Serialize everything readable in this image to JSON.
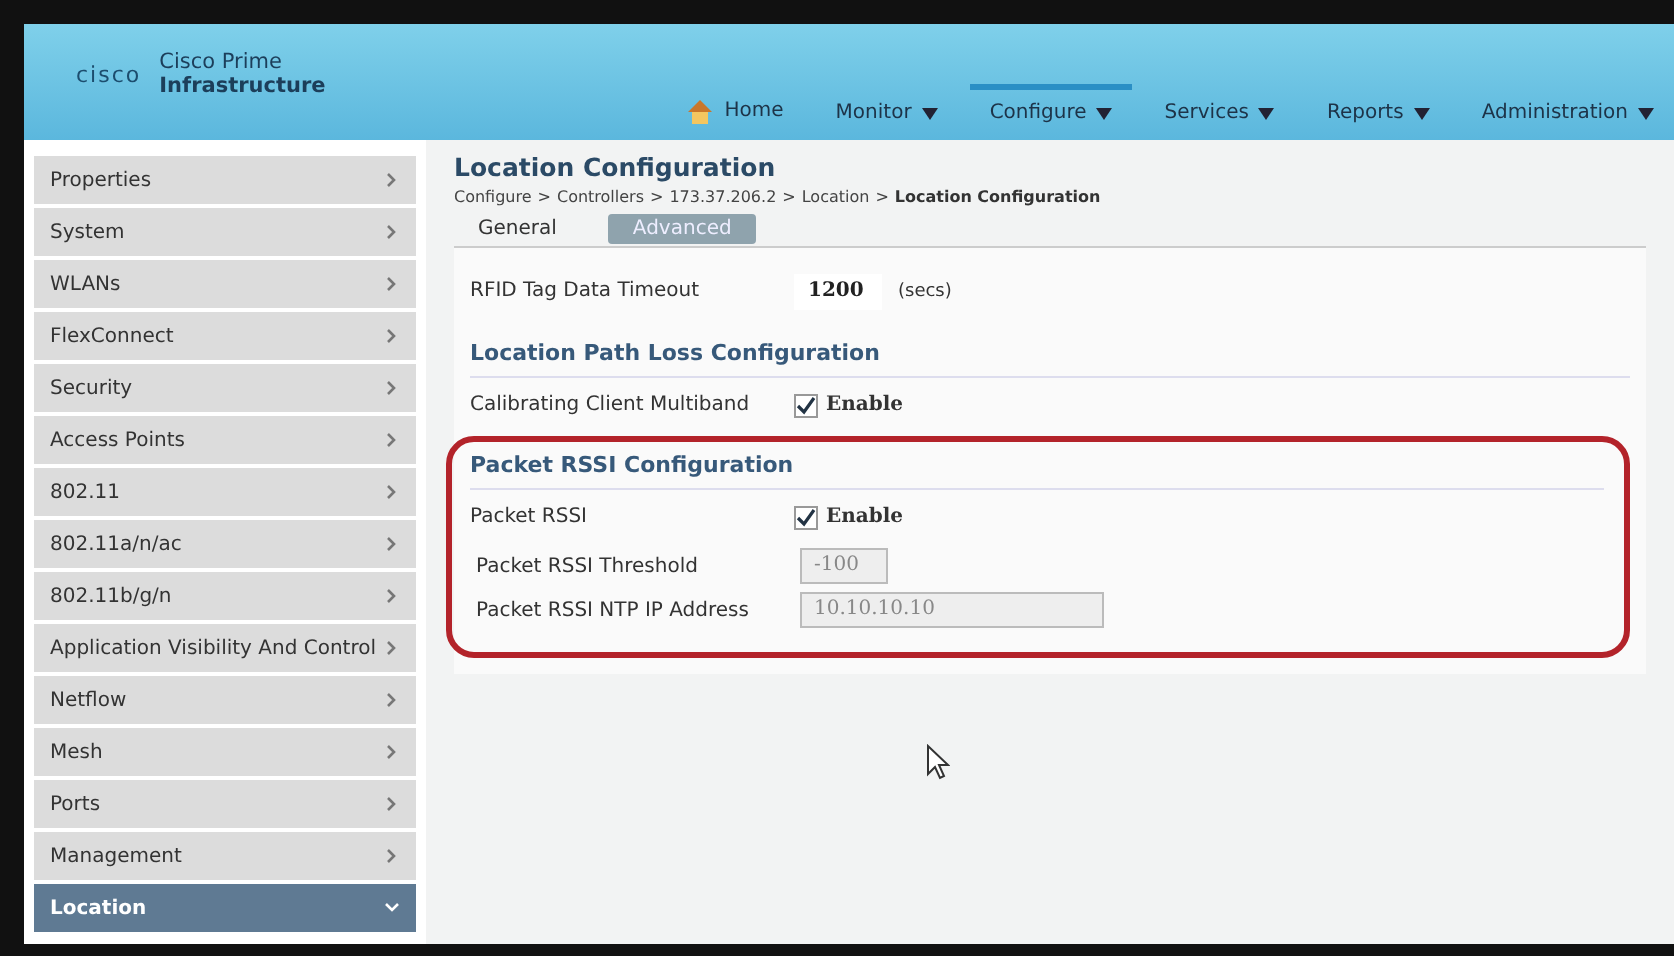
{
  "header": {
    "logo_top": "Cisco Prime",
    "logo_bottom": "Infrastructure",
    "brand": "cisco",
    "nav": [
      {
        "label": "Home",
        "kind": "home",
        "selected": false
      },
      {
        "label": "Monitor",
        "kind": "menu",
        "selected": false
      },
      {
        "label": "Configure",
        "kind": "menu",
        "selected": true
      },
      {
        "label": "Services",
        "kind": "menu",
        "selected": false
      },
      {
        "label": "Reports",
        "kind": "menu",
        "selected": false
      },
      {
        "label": "Administration",
        "kind": "menu",
        "selected": false
      }
    ]
  },
  "sidebar": {
    "items": [
      {
        "label": "Properties",
        "selected": false
      },
      {
        "label": "System",
        "selected": false
      },
      {
        "label": "WLANs",
        "selected": false
      },
      {
        "label": "FlexConnect",
        "selected": false
      },
      {
        "label": "Security",
        "selected": false
      },
      {
        "label": "Access Points",
        "selected": false
      },
      {
        "label": "802.11",
        "selected": false
      },
      {
        "label": "802.11a/n/ac",
        "selected": false
      },
      {
        "label": "802.11b/g/n",
        "selected": false
      },
      {
        "label": "Application Visibility And Control",
        "selected": false
      },
      {
        "label": "Netflow",
        "selected": false
      },
      {
        "label": "Mesh",
        "selected": false
      },
      {
        "label": "Ports",
        "selected": false
      },
      {
        "label": "Management",
        "selected": false
      },
      {
        "label": "Location",
        "selected": true
      }
    ]
  },
  "page": {
    "title": "Location Configuration",
    "breadcrumb": [
      {
        "label": "Configure",
        "current": false
      },
      {
        "sep": ">",
        "label": "Controllers",
        "current": false
      },
      {
        "sep": ">",
        "label": "173.37.206.2",
        "current": false
      },
      {
        "sep": ">",
        "label": "Location",
        "current": false
      },
      {
        "sep": ">",
        "label": "Location Configuration",
        "current": true
      }
    ],
    "tabs": [
      {
        "label": "General",
        "selected": false
      },
      {
        "label": "Advanced",
        "selected": true
      }
    ],
    "timeout": {
      "label": "RFID Tag Data Timeout",
      "value": "1200",
      "unit": "(secs)"
    },
    "sections": [
      {
        "title": "Location Path Loss Configuration",
        "highlighted": false,
        "rows": [
          {
            "kind": "checkbox",
            "label": "Calibrating Client Multiband",
            "checked": true,
            "option": "Enable"
          }
        ]
      },
      {
        "title": "Packet RSSI Configuration",
        "highlighted": true,
        "rows": [
          {
            "kind": "checkbox",
            "label": "Packet RSSI",
            "checked": true,
            "option": "Enable"
          },
          {
            "kind": "field",
            "label": "Packet RSSI Threshold",
            "value": "-100",
            "wide": false,
            "disabled": true
          },
          {
            "kind": "field",
            "label": "Packet RSSI NTP IP Address",
            "value": "10.10.10.10",
            "wide": true,
            "disabled": true
          }
        ]
      }
    ]
  }
}
